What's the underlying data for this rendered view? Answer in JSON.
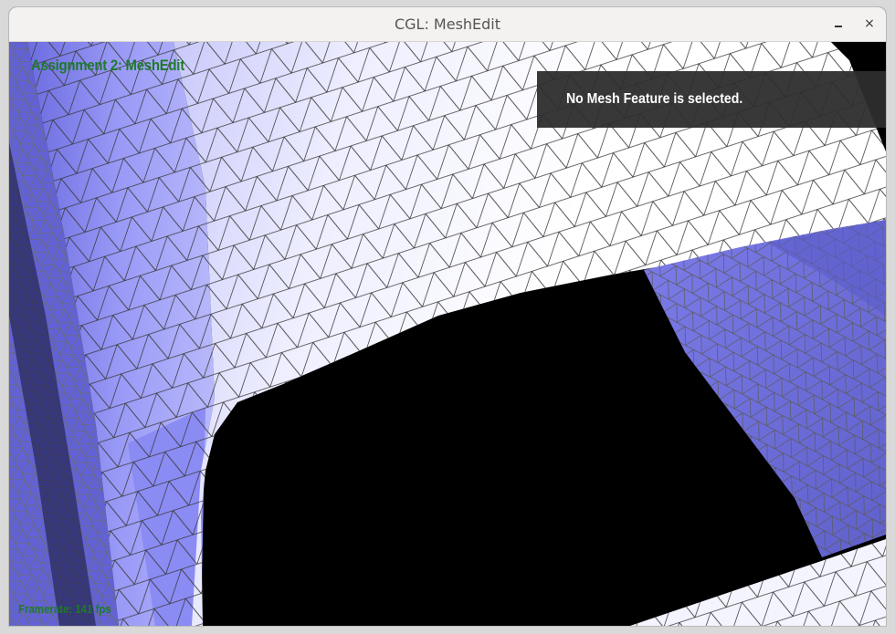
{
  "window": {
    "title": "CGL: MeshEdit",
    "minimize_symbol": "",
    "close_symbol": "×"
  },
  "overlay": {
    "assignment_title": "Assignment 2: MeshEdit",
    "selection_status": "No Mesh Feature is selected.",
    "framerate_label": "Framerate: 141 fps"
  },
  "colors": {
    "mesh_white": "#f4f4fb",
    "mesh_blue": "#8d8df5",
    "mesh_blue_dark": "#6f6fd8",
    "wire": "#3a3a3a",
    "overlay_text_green": "#1f7a2a",
    "panel_bg": "#2d2d2d"
  },
  "icons": {
    "minimize": "minimize-icon",
    "close": "close-icon"
  }
}
